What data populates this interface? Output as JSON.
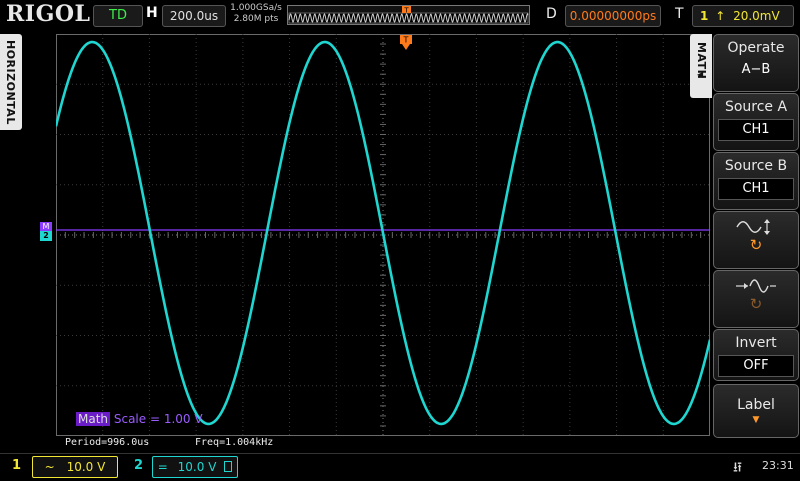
{
  "brand": "RIGOL",
  "top": {
    "mode": "TD",
    "h_label": "H",
    "timebase": "200.0us",
    "sample_rate": "1.000GSa/s",
    "memory_depth": "2.80M pts",
    "d_label": "D",
    "delay": "0.00000000ps",
    "t_label": "T",
    "trigger_level": "20.0mV"
  },
  "side_label": "HORIZONTAL",
  "menu": {
    "tab": "MATH",
    "operate_title": "Operate",
    "operate_value": "A−B",
    "source_a_title": "Source A",
    "source_a_value": "CH1",
    "source_b_title": "Source B",
    "source_b_value": "CH1",
    "invert_title": "Invert",
    "invert_value": "OFF",
    "label_title": "Label"
  },
  "markers": {
    "math": "M",
    "ch2": "2"
  },
  "math_status": {
    "tag": "Math",
    "scale": "Scale = 1.00 V"
  },
  "measurements": {
    "period": "Period=996.0us",
    "freq": "Freq=1.004kHz"
  },
  "channels": [
    {
      "num": "1",
      "coupling": "~",
      "scale": "10.0 V"
    },
    {
      "num": "2",
      "coupling": "=",
      "scale": "10.0 V"
    }
  ],
  "clock": "23:31",
  "colors": {
    "ch1": "#1fd6d0",
    "math": "#8a3cff",
    "delay": "#ff7a1a",
    "td": "#3cf04a"
  },
  "waveform": {
    "frequency_hz": 1004,
    "period_us": 996.0,
    "timebase_us_per_div": 200,
    "horizontal_divs": 14,
    "vertical_divs": 8,
    "amplitude_divs": 3.8,
    "offset_divs": 0.04
  }
}
